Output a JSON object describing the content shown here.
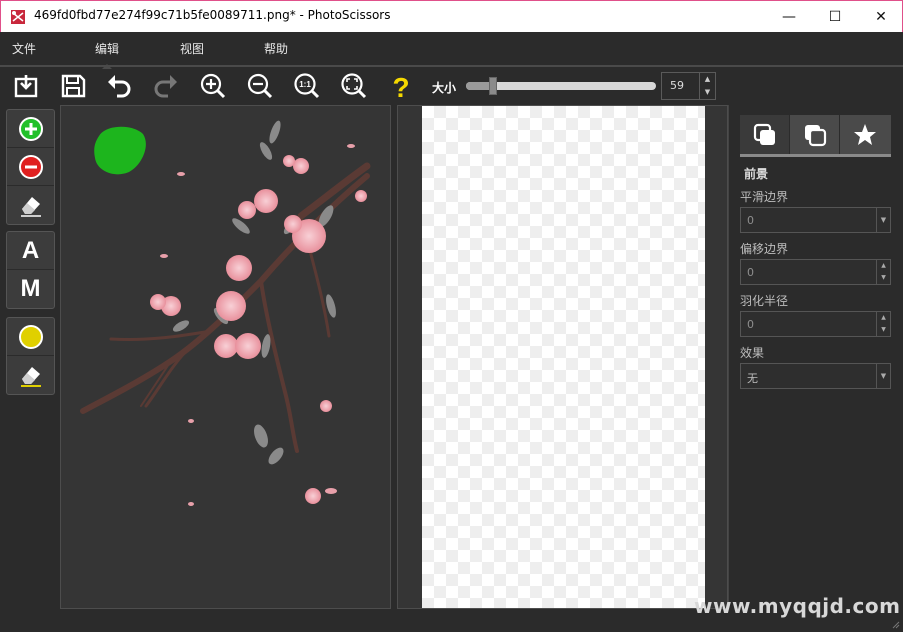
{
  "window": {
    "title": "469fd0fbd77e274f99c71b5fe0089711.png* - PhotoScissors",
    "controls": {
      "minimize": "—",
      "maximize": "☐",
      "close": "✕"
    }
  },
  "menu": [
    {
      "label": "文件"
    },
    {
      "label": "编辑"
    },
    {
      "label": "视图"
    },
    {
      "label": "帮助"
    }
  ],
  "toolbar": {
    "buttons": [
      {
        "name": "open-icon"
      },
      {
        "name": "save-icon"
      },
      {
        "name": "undo-icon"
      },
      {
        "name": "redo-icon"
      },
      {
        "name": "zoom-in-icon"
      },
      {
        "name": "zoom-out-icon"
      },
      {
        "name": "zoom-actual-icon",
        "text": "1:1"
      },
      {
        "name": "zoom-fit-icon"
      },
      {
        "name": "help-icon",
        "text": "?"
      }
    ],
    "size_label": "大小",
    "size_value": "59",
    "size_fraction": 0.14
  },
  "palette": {
    "letters": {
      "auto": "A",
      "manual": "M"
    }
  },
  "properties": {
    "heading": "前景",
    "smooth_label": "平滑边界",
    "smooth_value": "0",
    "offset_label": "偏移边界",
    "offset_value": "0",
    "feather_label": "羽化半径",
    "feather_value": "0",
    "effect_label": "效果",
    "effect_value": "无"
  },
  "watermark": "www.myqqjd.com",
  "colors": {
    "accent_green": "#1db51d",
    "add_green": "#22c02a",
    "remove_red": "#e02020",
    "keep_yellow": "#e0d000",
    "background": "#2b2b2b",
    "help_yellow": "#f5d800"
  }
}
